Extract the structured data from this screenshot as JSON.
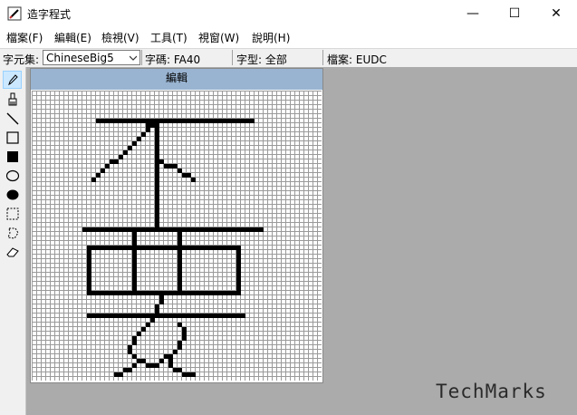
{
  "window": {
    "title": "造字程式",
    "minimize_glyph": "—",
    "maximize_glyph": "☐",
    "close_glyph": "✕"
  },
  "menu": [
    "檔案(F)",
    "編輯(E)",
    "檢視(V)",
    "工具(T)",
    "視窗(W)",
    "說明(H)"
  ],
  "infobar": {
    "charset_label": "字元集:",
    "charset_value": "ChineseBig5",
    "code_label": "字碼: FA40",
    "font_label": "字型: 全部",
    "file_label": "檔案: EUDC"
  },
  "tools": [
    {
      "name": "pencil-icon",
      "active": true
    },
    {
      "name": "brush-icon"
    },
    {
      "name": "line-icon"
    },
    {
      "name": "hollow-rectangle-icon"
    },
    {
      "name": "filled-rectangle-icon"
    },
    {
      "name": "hollow-ellipse-icon"
    },
    {
      "name": "filled-ellipse-icon"
    },
    {
      "name": "rectangular-select-icon"
    },
    {
      "name": "freeform-select-icon"
    },
    {
      "name": "eraser-icon"
    }
  ],
  "editor": {
    "title": "編輯",
    "grid_cells": 64
  },
  "glyph_strokes": [
    {
      "cells": [
        [
          14,
          6
        ],
        [
          15,
          6
        ],
        [
          16,
          6
        ],
        [
          17,
          6
        ],
        [
          18,
          6
        ],
        [
          19,
          6
        ],
        [
          20,
          6
        ],
        [
          21,
          6
        ],
        [
          22,
          6
        ],
        [
          23,
          6
        ],
        [
          24,
          6
        ],
        [
          25,
          6
        ],
        [
          26,
          6
        ],
        [
          27,
          6
        ],
        [
          28,
          6
        ],
        [
          29,
          6
        ],
        [
          30,
          6
        ],
        [
          31,
          6
        ],
        [
          32,
          6
        ],
        [
          33,
          6
        ],
        [
          34,
          6
        ],
        [
          35,
          6
        ],
        [
          36,
          6
        ],
        [
          37,
          6
        ],
        [
          38,
          6
        ],
        [
          39,
          6
        ],
        [
          40,
          6
        ],
        [
          41,
          6
        ],
        [
          42,
          6
        ],
        [
          43,
          6
        ],
        [
          44,
          6
        ],
        [
          45,
          6
        ],
        [
          46,
          6
        ],
        [
          47,
          6
        ],
        [
          48,
          6
        ]
      ]
    },
    {
      "cells": [
        [
          25,
          7
        ],
        [
          26,
          7
        ],
        [
          25,
          8
        ],
        [
          24,
          9
        ],
        [
          23,
          10
        ],
        [
          22,
          11
        ],
        [
          21,
          12
        ],
        [
          20,
          13
        ],
        [
          19,
          14
        ],
        [
          18,
          15
        ],
        [
          17,
          15
        ],
        [
          16,
          16
        ],
        [
          15,
          17
        ],
        [
          14,
          18
        ],
        [
          13,
          19
        ]
      ]
    },
    {
      "cells": [
        [
          27,
          7
        ],
        [
          27,
          8
        ],
        [
          27,
          9
        ],
        [
          27,
          10
        ],
        [
          27,
          11
        ],
        [
          27,
          12
        ],
        [
          27,
          13
        ],
        [
          27,
          14
        ],
        [
          27,
          15
        ],
        [
          27,
          16
        ],
        [
          27,
          17
        ],
        [
          27,
          18
        ],
        [
          27,
          19
        ],
        [
          27,
          20
        ],
        [
          27,
          21
        ],
        [
          27,
          22
        ],
        [
          27,
          23
        ],
        [
          27,
          24
        ],
        [
          27,
          25
        ],
        [
          27,
          26
        ],
        [
          27,
          27
        ],
        [
          27,
          28
        ],
        [
          27,
          29
        ]
      ]
    },
    {
      "cells": [
        [
          28,
          15
        ],
        [
          29,
          16
        ],
        [
          30,
          16
        ],
        [
          31,
          16
        ],
        [
          32,
          17
        ],
        [
          33,
          18
        ],
        [
          34,
          18
        ],
        [
          35,
          19
        ]
      ]
    },
    {
      "cells": [
        [
          11,
          30
        ],
        [
          12,
          30
        ],
        [
          13,
          30
        ],
        [
          14,
          30
        ],
        [
          15,
          30
        ],
        [
          16,
          30
        ],
        [
          17,
          30
        ],
        [
          18,
          30
        ],
        [
          19,
          30
        ],
        [
          20,
          30
        ],
        [
          21,
          30
        ],
        [
          22,
          30
        ],
        [
          23,
          30
        ],
        [
          24,
          30
        ],
        [
          25,
          30
        ],
        [
          26,
          30
        ],
        [
          27,
          30
        ],
        [
          28,
          30
        ],
        [
          29,
          30
        ],
        [
          30,
          30
        ],
        [
          31,
          30
        ],
        [
          32,
          30
        ],
        [
          33,
          30
        ],
        [
          34,
          30
        ],
        [
          35,
          30
        ],
        [
          36,
          30
        ],
        [
          37,
          30
        ],
        [
          38,
          30
        ],
        [
          39,
          30
        ],
        [
          40,
          30
        ],
        [
          41,
          30
        ],
        [
          42,
          30
        ],
        [
          43,
          30
        ],
        [
          44,
          30
        ],
        [
          45,
          30
        ],
        [
          46,
          30
        ],
        [
          47,
          30
        ],
        [
          48,
          30
        ],
        [
          49,
          30
        ],
        [
          50,
          30
        ]
      ]
    },
    {
      "cells": [
        [
          22,
          31
        ],
        [
          22,
          32
        ],
        [
          22,
          33
        ],
        [
          32,
          31
        ],
        [
          32,
          32
        ],
        [
          32,
          33
        ]
      ]
    },
    {
      "cells": [
        [
          12,
          34
        ],
        [
          13,
          34
        ],
        [
          14,
          34
        ],
        [
          15,
          34
        ],
        [
          16,
          34
        ],
        [
          17,
          34
        ],
        [
          18,
          34
        ],
        [
          19,
          34
        ],
        [
          20,
          34
        ],
        [
          21,
          34
        ],
        [
          22,
          34
        ],
        [
          23,
          34
        ],
        [
          24,
          34
        ],
        [
          25,
          34
        ],
        [
          26,
          34
        ],
        [
          27,
          34
        ],
        [
          28,
          34
        ],
        [
          29,
          34
        ],
        [
          30,
          34
        ],
        [
          31,
          34
        ],
        [
          32,
          34
        ],
        [
          33,
          34
        ],
        [
          34,
          34
        ],
        [
          35,
          34
        ],
        [
          36,
          34
        ],
        [
          37,
          34
        ],
        [
          38,
          34
        ],
        [
          39,
          34
        ],
        [
          40,
          34
        ],
        [
          41,
          34
        ],
        [
          42,
          34
        ],
        [
          43,
          34
        ],
        [
          44,
          34
        ],
        [
          45,
          34
        ]
      ]
    },
    {
      "cells": [
        [
          12,
          35
        ],
        [
          12,
          36
        ],
        [
          12,
          37
        ],
        [
          12,
          38
        ],
        [
          12,
          39
        ],
        [
          12,
          40
        ],
        [
          12,
          41
        ],
        [
          12,
          42
        ],
        [
          12,
          43
        ],
        [
          45,
          35
        ],
        [
          45,
          36
        ],
        [
          45,
          37
        ],
        [
          45,
          38
        ],
        [
          45,
          39
        ],
        [
          45,
          40
        ],
        [
          45,
          41
        ],
        [
          45,
          42
        ],
        [
          45,
          43
        ]
      ]
    },
    {
      "cells": [
        [
          22,
          35
        ],
        [
          22,
          36
        ],
        [
          22,
          37
        ],
        [
          22,
          38
        ],
        [
          22,
          39
        ],
        [
          22,
          40
        ],
        [
          22,
          41
        ],
        [
          22,
          42
        ],
        [
          22,
          43
        ],
        [
          32,
          35
        ],
        [
          32,
          36
        ],
        [
          32,
          37
        ],
        [
          32,
          38
        ],
        [
          32,
          39
        ],
        [
          32,
          40
        ],
        [
          32,
          41
        ],
        [
          32,
          42
        ],
        [
          32,
          43
        ]
      ]
    },
    {
      "cells": [
        [
          12,
          44
        ],
        [
          13,
          44
        ],
        [
          14,
          44
        ],
        [
          15,
          44
        ],
        [
          16,
          44
        ],
        [
          17,
          44
        ],
        [
          18,
          44
        ],
        [
          19,
          44
        ],
        [
          20,
          44
        ],
        [
          21,
          44
        ],
        [
          22,
          44
        ],
        [
          23,
          44
        ],
        [
          24,
          44
        ],
        [
          25,
          44
        ],
        [
          26,
          44
        ],
        [
          27,
          44
        ],
        [
          28,
          44
        ],
        [
          29,
          44
        ],
        [
          30,
          44
        ],
        [
          31,
          44
        ],
        [
          32,
          44
        ],
        [
          33,
          44
        ],
        [
          34,
          44
        ],
        [
          35,
          44
        ],
        [
          36,
          44
        ],
        [
          37,
          44
        ],
        [
          38,
          44
        ],
        [
          39,
          44
        ],
        [
          40,
          44
        ],
        [
          41,
          44
        ],
        [
          42,
          44
        ],
        [
          43,
          44
        ],
        [
          44,
          44
        ],
        [
          45,
          44
        ]
      ]
    },
    {
      "cells": [
        [
          28,
          45
        ],
        [
          28,
          46
        ],
        [
          27,
          47
        ],
        [
          27,
          48
        ]
      ]
    },
    {
      "cells": [
        [
          12,
          49
        ],
        [
          13,
          49
        ],
        [
          14,
          49
        ],
        [
          15,
          49
        ],
        [
          16,
          49
        ],
        [
          17,
          49
        ],
        [
          18,
          49
        ],
        [
          19,
          49
        ],
        [
          20,
          49
        ],
        [
          21,
          49
        ],
        [
          22,
          49
        ],
        [
          23,
          49
        ],
        [
          24,
          49
        ],
        [
          25,
          49
        ],
        [
          26,
          49
        ],
        [
          27,
          49
        ],
        [
          28,
          49
        ],
        [
          29,
          49
        ],
        [
          30,
          49
        ],
        [
          31,
          49
        ],
        [
          32,
          49
        ],
        [
          33,
          49
        ],
        [
          34,
          49
        ],
        [
          35,
          49
        ],
        [
          36,
          49
        ],
        [
          37,
          49
        ],
        [
          38,
          49
        ],
        [
          39,
          49
        ],
        [
          40,
          49
        ],
        [
          41,
          49
        ],
        [
          42,
          49
        ],
        [
          43,
          49
        ],
        [
          44,
          49
        ],
        [
          45,
          49
        ],
        [
          46,
          49
        ]
      ]
    },
    {
      "cells": [
        [
          26,
          50
        ],
        [
          25,
          51
        ],
        [
          24,
          52
        ],
        [
          23,
          53
        ],
        [
          22,
          54
        ],
        [
          22,
          55
        ],
        [
          21,
          56
        ],
        [
          21,
          57
        ],
        [
          22,
          58
        ],
        [
          23,
          59
        ],
        [
          24,
          59
        ],
        [
          25,
          60
        ],
        [
          26,
          60
        ],
        [
          27,
          60
        ],
        [
          28,
          59
        ],
        [
          29,
          58
        ],
        [
          30,
          58
        ],
        [
          31,
          57
        ],
        [
          32,
          56
        ],
        [
          32,
          55
        ],
        [
          33,
          54
        ],
        [
          33,
          53
        ],
        [
          33,
          52
        ],
        [
          32,
          51
        ]
      ]
    },
    {
      "cells": [
        [
          22,
          60
        ],
        [
          21,
          61
        ],
        [
          20,
          61
        ],
        [
          19,
          62
        ],
        [
          18,
          62
        ],
        [
          30,
          59
        ],
        [
          30,
          60
        ],
        [
          31,
          61
        ],
        [
          32,
          61
        ],
        [
          33,
          62
        ],
        [
          34,
          62
        ],
        [
          35,
          62
        ]
      ]
    }
  ],
  "watermark": "TechMarks"
}
